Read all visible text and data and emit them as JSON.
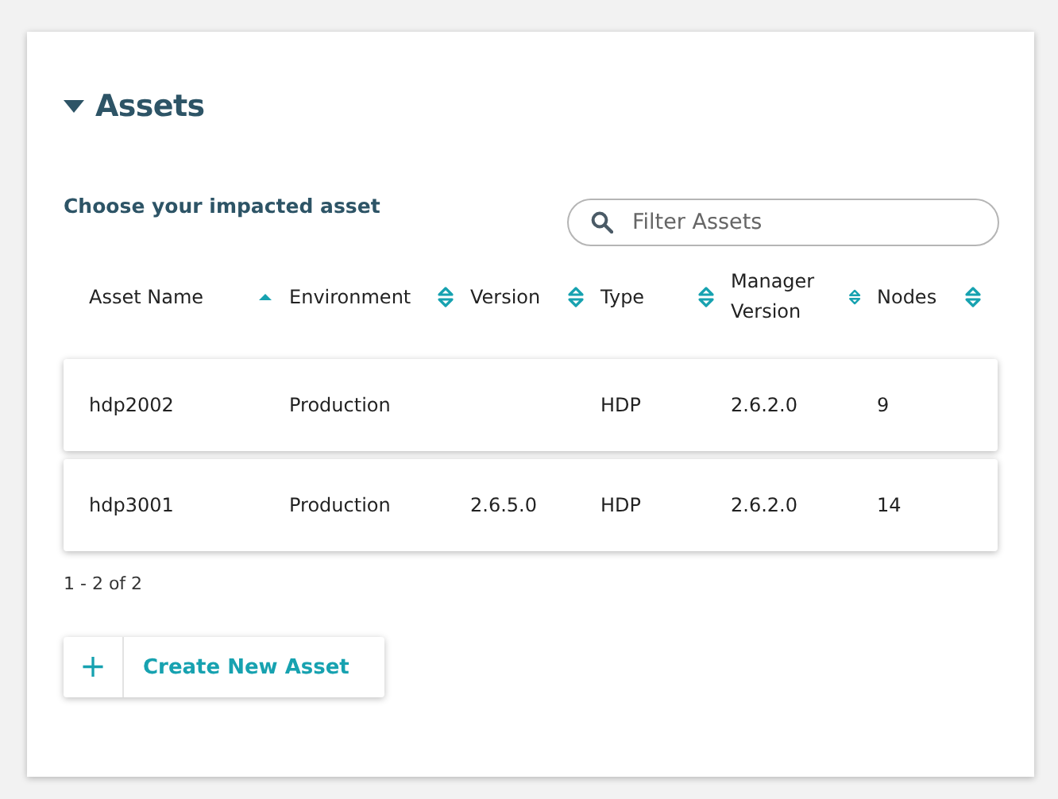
{
  "panel": {
    "title": "Assets",
    "expanded": true
  },
  "prompt": "Choose your impacted asset",
  "search": {
    "placeholder": "Filter Assets"
  },
  "table": {
    "columns": [
      {
        "label": "Asset Name",
        "sorted": true
      },
      {
        "label": "Environment",
        "sorted": false
      },
      {
        "label": "Version",
        "sorted": false
      },
      {
        "label": "Type",
        "sorted": false
      },
      {
        "label": "Manager Version",
        "sorted": false
      },
      {
        "label": "Nodes",
        "sorted": false
      }
    ],
    "rows": [
      [
        "hdp2002",
        "Production",
        null,
        "HDP",
        "2.6.2.0",
        "9"
      ],
      [
        "hdp3001",
        "Production",
        "2.6.5.0",
        "HDP",
        "2.6.2.0",
        "14"
      ]
    ]
  },
  "pagination": "1 - 2 of 2",
  "create_button": {
    "icon": "+",
    "label": "Create New Asset"
  }
}
